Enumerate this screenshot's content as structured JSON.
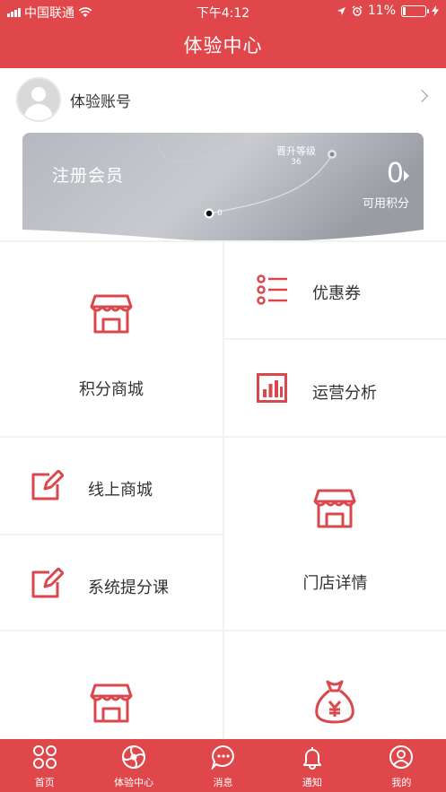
{
  "status_bar": {
    "carrier": "中国联通",
    "time": "下午4:12",
    "battery": "11%",
    "battery_level": 0.11
  },
  "header": {
    "title": "体验中心"
  },
  "account": {
    "name": "体验账号"
  },
  "member_card": {
    "level": "注册会员",
    "upgrade_label": "晋升等级",
    "upgrade_value": "36",
    "progress_value": "0",
    "points": "0",
    "points_label": "可用积分"
  },
  "menu": {
    "points_mall": "积分商城",
    "coupons": "优惠券",
    "analytics": "运营分析",
    "online_mall": "线上商城",
    "store_details": "门店详情",
    "course": "系统提分课"
  },
  "tabbar": {
    "home": "首页",
    "center": "体验中心",
    "messages": "消息",
    "notice": "通知",
    "mine": "我的"
  },
  "colors": {
    "brand": "#e0474b",
    "icon": "#d9484c"
  }
}
